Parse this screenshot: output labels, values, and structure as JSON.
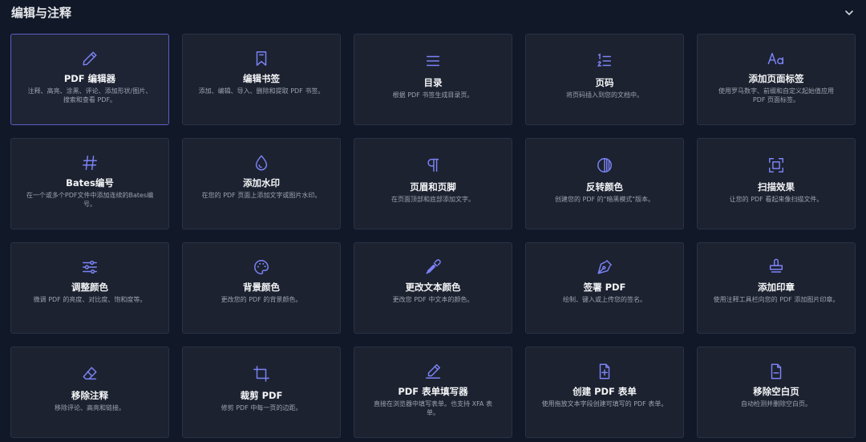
{
  "section": {
    "title": "编辑与注释",
    "collapse_icon": "chevron-down-icon"
  },
  "colors": {
    "background": "#111827",
    "card": "#1c2230",
    "card_border": "#2a3242",
    "accent": "#7c83f5",
    "active_border": "#5b5fc7"
  },
  "tools": [
    {
      "name": "PDF 编辑器",
      "desc": "注释、高亮、涂黑、评论、添加形状/图片、搜索和查看 PDF。",
      "icon": "pencil-icon"
    },
    {
      "name": "编辑书签",
      "desc": "添加、编辑、导入、删除和提取 PDF 书签。",
      "icon": "bookmark-icon"
    },
    {
      "name": "目录",
      "desc": "根据 PDF 书签生成目录页。",
      "icon": "list-icon"
    },
    {
      "name": "页码",
      "desc": "将页码插入到您的文档中。",
      "icon": "numbered-list-icon"
    },
    {
      "name": "添加页面标签",
      "desc": "使用罗马数字、前缀和自定义起始值应用 PDF 页面标签。",
      "icon": "text-size-icon"
    },
    {
      "name": "Bates编号",
      "desc": "在一个或多个PDF文件中添加连续的Bates编号。",
      "icon": "hash-icon"
    },
    {
      "name": "添加水印",
      "desc": "在您的 PDF 页面上添加文字或图片水印。",
      "icon": "droplet-icon"
    },
    {
      "name": "页眉和页脚",
      "desc": "在页面顶部和底部添加文字。",
      "icon": "pilcrow-icon"
    },
    {
      "name": "反转颜色",
      "desc": "创建您的 PDF 的\"暗黑模式\"版本。",
      "icon": "contrast-icon"
    },
    {
      "name": "扫描效果",
      "desc": "让您的 PDF 看起来像扫描文件。",
      "icon": "scan-icon"
    },
    {
      "name": "调整颜色",
      "desc": "微调 PDF 的亮度、对比度、饱和度等。",
      "icon": "sliders-icon"
    },
    {
      "name": "背景颜色",
      "desc": "更改您的 PDF 的背景颜色。",
      "icon": "palette-icon"
    },
    {
      "name": "更改文本颜色",
      "desc": "更改您 PDF 中文本的颜色。",
      "icon": "eyedropper-icon"
    },
    {
      "name": "签署 PDF",
      "desc": "绘制、键入或上传您的签名。",
      "icon": "pen-nib-icon"
    },
    {
      "name": "添加印章",
      "desc": "使用注释工具栏向您的 PDF 添加图片印章。",
      "icon": "stamp-icon"
    },
    {
      "name": "移除注释",
      "desc": "移除评论、高亮和链接。",
      "icon": "eraser-icon"
    },
    {
      "name": "裁剪 PDF",
      "desc": "修剪 PDF 中每一页的边距。",
      "icon": "crop-icon"
    },
    {
      "name": "PDF 表单填写器",
      "desc": "直接在浏览器中填写表单。也支持 XFA 表单。",
      "icon": "form-edit-icon"
    },
    {
      "name": "创建 PDF 表单",
      "desc": "使用拖放文本字段创建可填写的 PDF 表单。",
      "icon": "file-plus-icon"
    },
    {
      "name": "移除空白页",
      "desc": "自动检测并删除空白页。",
      "icon": "file-minus-icon"
    }
  ]
}
